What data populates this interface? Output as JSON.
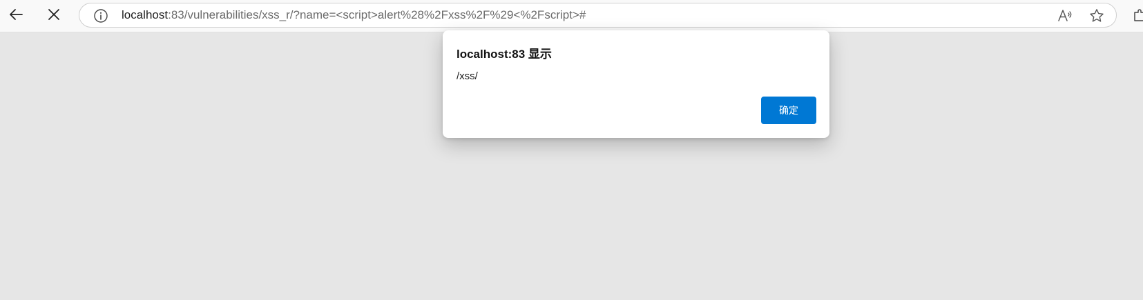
{
  "browser": {
    "address_bar": {
      "host": "localhost",
      "rest": ":83/vulnerabilities/xss_r/?name=<script>alert%28%2Fxss%2F%29<%2Fscript>#"
    },
    "icons": {
      "back": "back-arrow-icon",
      "stop": "close-icon",
      "info": "info-icon",
      "read_aloud": "read-aloud-icon",
      "favorite": "star-icon",
      "extensions": "extensions-icon"
    }
  },
  "dialog": {
    "title": "localhost:83 显示",
    "message": "/xss/",
    "ok_label": "确定"
  },
  "colors": {
    "page_background": "#e6e6e6",
    "accent": "#0078d4"
  }
}
